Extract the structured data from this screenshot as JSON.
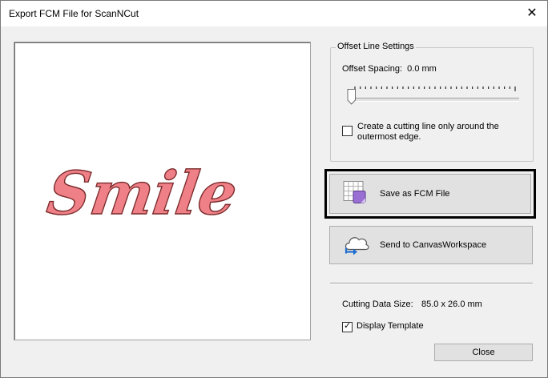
{
  "window": {
    "title": "Export FCM File for ScanNCut",
    "close_glyph": "✕"
  },
  "preview": {
    "text": "Smile",
    "fill_color": "#f08088",
    "stroke_color": "#7a2a2a"
  },
  "offset_settings": {
    "group_label": "Offset Line Settings",
    "spacing_label": "Offset Spacing:",
    "spacing_value": "0.0 mm",
    "slider_fraction": 0.0,
    "outer_edge_checkbox_label": "Create a cutting line only around the outermost edge.",
    "outer_edge_checked": false
  },
  "buttons": {
    "save_fcm": "Save as FCM File",
    "send_canvas": "Send to CanvasWorkspace",
    "close": "Close"
  },
  "icons": {
    "save_fcm": "fcm-grid-icon",
    "send_canvas": "cloud-upload-icon"
  },
  "cutting": {
    "size_label": "Cutting Data Size:",
    "size_value": "85.0 x 26.0 mm"
  },
  "template": {
    "label": "Display Template",
    "checked": true,
    "check_glyph": "✓"
  }
}
